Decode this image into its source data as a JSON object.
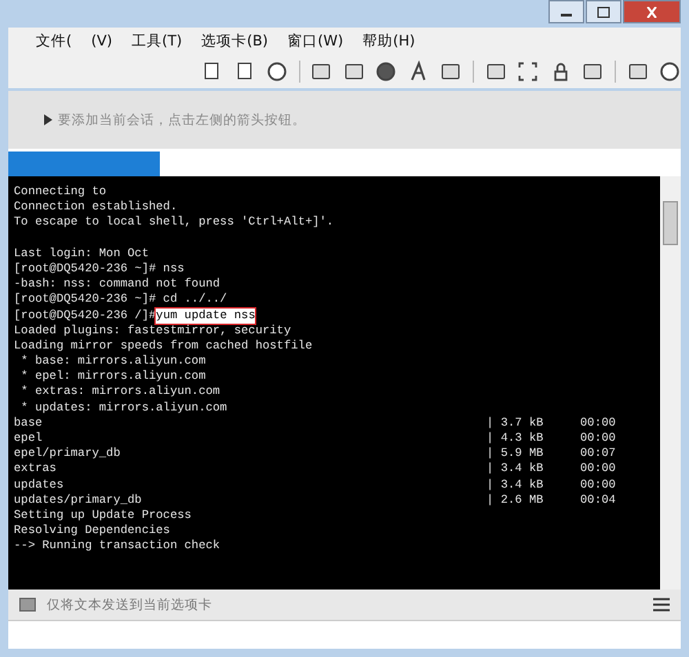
{
  "menu": [
    {
      "label": "文件("
    },
    {
      "label": "(V)"
    },
    {
      "label": "工具(T)"
    },
    {
      "label": "选项卡(B)"
    },
    {
      "label": "窗口(W)"
    },
    {
      "label": "帮助(H)"
    }
  ],
  "session_hint": "要添加当前会话，点击左侧的箭头按钮。",
  "terminal": {
    "lines": [
      {
        "kind": "text",
        "text": "Connecting to"
      },
      {
        "kind": "text",
        "text": "Connection established."
      },
      {
        "kind": "text",
        "text": "To escape to local shell, press 'Ctrl+Alt+]'."
      },
      {
        "kind": "blank"
      },
      {
        "kind": "text",
        "text": "Last login: Mon Oct"
      },
      {
        "kind": "text",
        "text": "[root@DQ5420-236 ~]# nss"
      },
      {
        "kind": "text",
        "text": "-bash: nss: command not found"
      },
      {
        "kind": "text",
        "text": "[root@DQ5420-236 ~]# cd ../../"
      },
      {
        "kind": "command",
        "prompt": "[root@DQ5420-236 /]#",
        "command": "yum update nss",
        "highlighted": true
      },
      {
        "kind": "text",
        "text": "Loaded plugins: fastestmirror, security"
      },
      {
        "kind": "text",
        "text": "Loading mirror speeds from cached hostfile"
      },
      {
        "kind": "text",
        "text": " * base: mirrors.aliyun.com"
      },
      {
        "kind": "text",
        "text": " * epel: mirrors.aliyun.com"
      },
      {
        "kind": "text",
        "text": " * extras: mirrors.aliyun.com"
      },
      {
        "kind": "text",
        "text": " * updates: mirrors.aliyun.com"
      },
      {
        "kind": "repo",
        "name": "base",
        "size": "| 3.7 kB",
        "time": "00:00"
      },
      {
        "kind": "repo",
        "name": "epel",
        "size": "| 4.3 kB",
        "time": "00:00"
      },
      {
        "kind": "repo",
        "name": "epel/primary_db",
        "size": "| 5.9 MB",
        "time": "00:07"
      },
      {
        "kind": "repo",
        "name": "extras",
        "size": "| 3.4 kB",
        "time": "00:00"
      },
      {
        "kind": "repo",
        "name": "updates",
        "size": "| 3.4 kB",
        "time": "00:00"
      },
      {
        "kind": "repo",
        "name": "updates/primary_db",
        "size": "| 2.6 MB",
        "time": "00:04"
      },
      {
        "kind": "text",
        "text": "Setting up Update Process"
      },
      {
        "kind": "text",
        "text": "Resolving Dependencies"
      },
      {
        "kind": "text",
        "text": "--> Running transaction check"
      }
    ]
  },
  "send_bar": {
    "placeholder": "仅将文本发送到当前选项卡"
  }
}
